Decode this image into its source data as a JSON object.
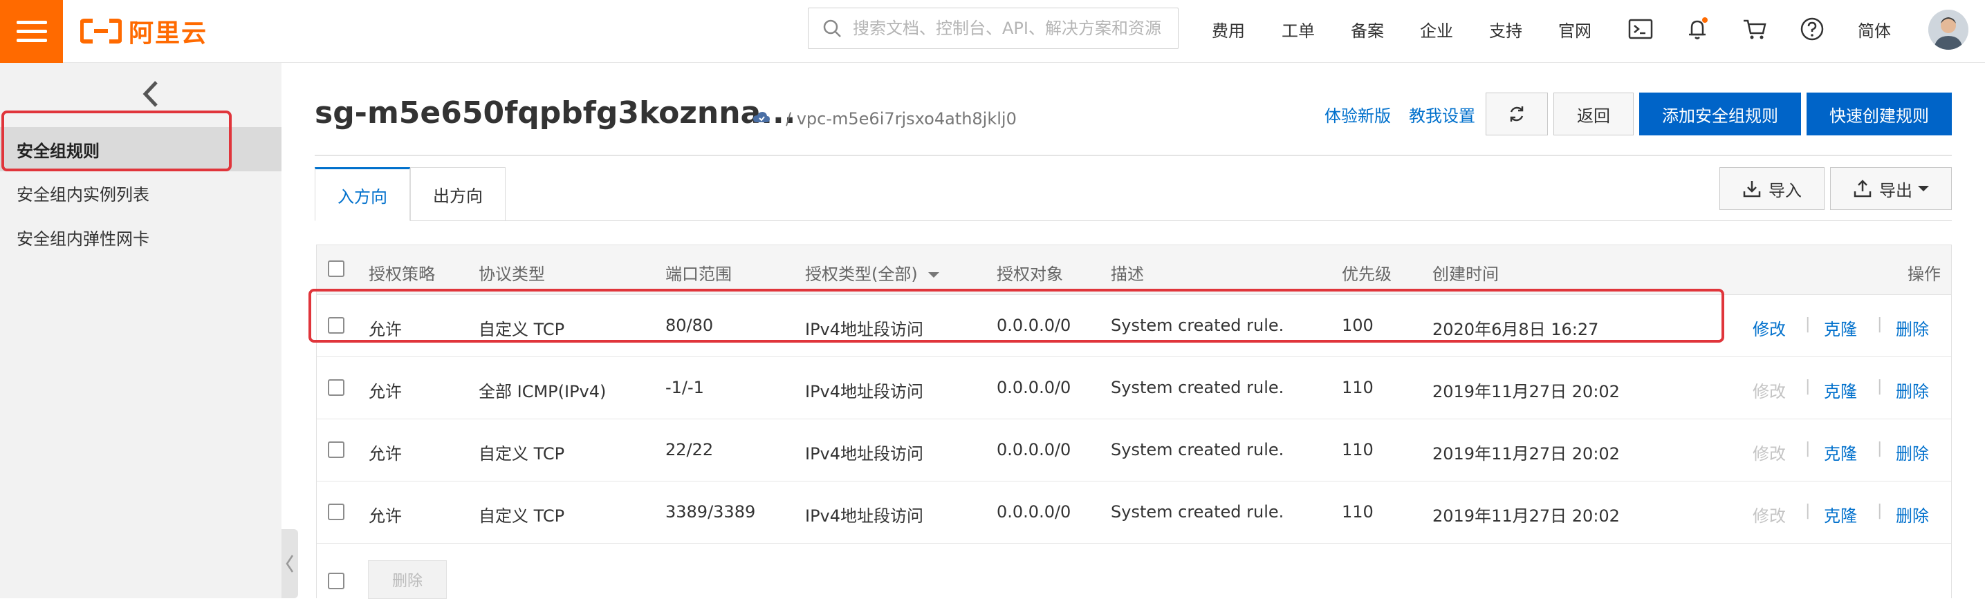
{
  "topbar": {
    "logo_text": "阿里云",
    "search_placeholder": "搜索文档、控制台、API、解决方案和资源",
    "nav": [
      "费用",
      "工单",
      "备案",
      "企业",
      "支持",
      "官网"
    ],
    "lang": "简体",
    "icons": [
      "terminal-icon",
      "bell-icon",
      "cart-icon",
      "help-icon"
    ],
    "brand_color": "#ff6a00"
  },
  "sidebar": {
    "items": [
      {
        "label": "安全组规则",
        "active": true
      },
      {
        "label": "安全组内实例列表",
        "active": false
      },
      {
        "label": "安全组内弹性网卡",
        "active": false
      }
    ]
  },
  "header": {
    "title": "sg-m5e650fqpbfg3koznna...",
    "vpc": "/ vpc-m5e6i7rjsxo4ath8jklj0",
    "link_new": "体验新版",
    "link_teach": "教我设置",
    "back": "返回",
    "add_rule": "添加安全组规则",
    "quick_create": "快速创建规则",
    "accent": "#0064c8"
  },
  "tabs": [
    {
      "label": "入方向",
      "active": true
    },
    {
      "label": "出方向",
      "active": false
    }
  ],
  "toolbar": {
    "import": "导入",
    "export": "导出"
  },
  "table": {
    "columns": [
      "授权策略",
      "协议类型",
      "端口范围",
      "授权类型(全部)",
      "授权对象",
      "描述",
      "优先级",
      "创建时间",
      "操作"
    ],
    "rows": [
      {
        "policy": "允许",
        "protocol": "自定义 TCP",
        "port": "80/80",
        "auth_type": "IPv4地址段访问",
        "target": "0.0.0.0/0",
        "desc": "System created rule.",
        "priority": "100",
        "created": "2020年6月8日 16:27",
        "modify_enabled": true
      },
      {
        "policy": "允许",
        "protocol": "全部 ICMP(IPv4)",
        "port": "-1/-1",
        "auth_type": "IPv4地址段访问",
        "target": "0.0.0.0/0",
        "desc": "System created rule.",
        "priority": "110",
        "created": "2019年11月27日 20:02",
        "modify_enabled": false
      },
      {
        "policy": "允许",
        "protocol": "自定义 TCP",
        "port": "22/22",
        "auth_type": "IPv4地址段访问",
        "target": "0.0.0.0/0",
        "desc": "System created rule.",
        "priority": "110",
        "created": "2019年11月27日 20:02",
        "modify_enabled": false
      },
      {
        "policy": "允许",
        "protocol": "自定义 TCP",
        "port": "3389/3389",
        "auth_type": "IPv4地址段访问",
        "target": "0.0.0.0/0",
        "desc": "System created rule.",
        "priority": "110",
        "created": "2019年11月27日 20:02",
        "modify_enabled": false
      }
    ],
    "ops": {
      "modify": "修改",
      "clone": "克隆",
      "delete": "删除",
      "sep": "|"
    },
    "batch_delete": "删除"
  }
}
